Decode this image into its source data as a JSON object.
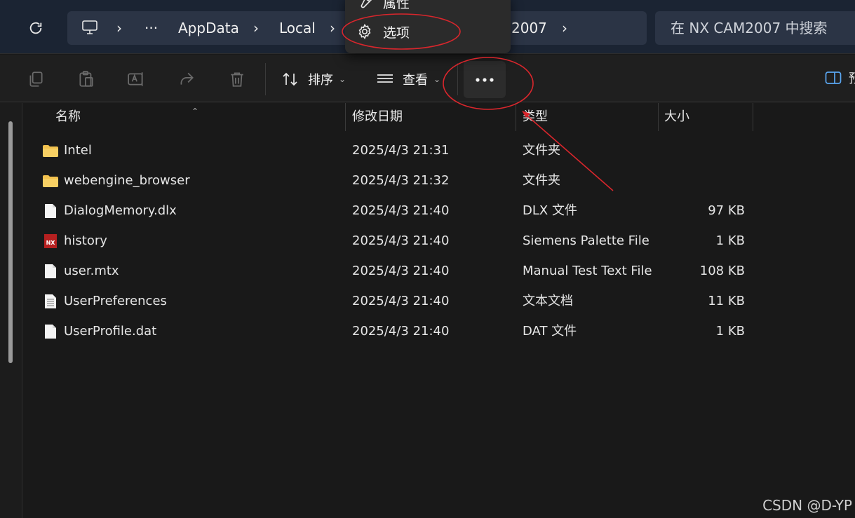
{
  "address": {
    "crumbs": [
      "AppData",
      "Local",
      "2007"
    ],
    "search_placeholder": "在 NX CAM2007 中搜索"
  },
  "toolbar": {
    "sort_label": "排序",
    "view_label": "查看",
    "preview_label": "预"
  },
  "menu": {
    "items": [
      {
        "label": "属性",
        "icon": "wrench-icon"
      },
      {
        "label": "选项",
        "icon": "gear-icon"
      }
    ]
  },
  "columns": {
    "name": "名称",
    "modified": "修改日期",
    "type": "类型",
    "size": "大小"
  },
  "files": [
    {
      "name": "Intel",
      "modified": "2025/4/3 21:31",
      "type": "文件夹",
      "size": "",
      "icon": "folder-icon"
    },
    {
      "name": "webengine_browser",
      "modified": "2025/4/3 21:32",
      "type": "文件夹",
      "size": "",
      "icon": "folder-icon"
    },
    {
      "name": "DialogMemory.dlx",
      "modified": "2025/4/3 21:40",
      "type": "DLX 文件",
      "size": "97 KB",
      "icon": "file-icon"
    },
    {
      "name": "history",
      "modified": "2025/4/3 21:40",
      "type": "Siemens Palette File",
      "size": "1 KB",
      "icon": "nx-file-icon"
    },
    {
      "name": "user.mtx",
      "modified": "2025/4/3 21:40",
      "type": "Manual Test Text File",
      "size": "108 KB",
      "icon": "file-icon"
    },
    {
      "name": "UserPreferences",
      "modified": "2025/4/3 21:40",
      "type": "文本文档",
      "size": "11 KB",
      "icon": "text-file-icon"
    },
    {
      "name": "UserProfile.dat",
      "modified": "2025/4/3 21:40",
      "type": "DAT 文件",
      "size": "1 KB",
      "icon": "file-icon"
    }
  ],
  "watermark": "CSDN @D-YP",
  "colors": {
    "annotation": "#d9262c",
    "folder": "#f2c14e",
    "nx_icon": "#b52020"
  }
}
